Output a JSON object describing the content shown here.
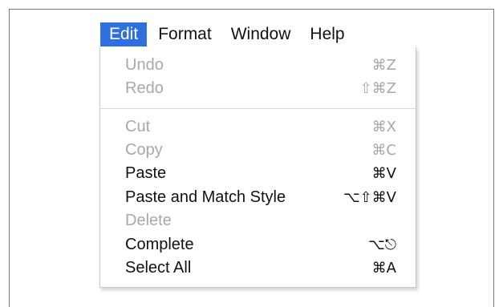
{
  "menubar": {
    "items": [
      {
        "label": "Edit",
        "active": true
      },
      {
        "label": "Format"
      },
      {
        "label": "Window"
      },
      {
        "label": "Help"
      }
    ]
  },
  "edit_menu": {
    "items": [
      {
        "label": "Undo",
        "shortcut": "⌘Z",
        "enabled": false
      },
      {
        "label": "Redo",
        "shortcut": "⇧⌘Z",
        "enabled": false
      },
      {
        "label": "Cut",
        "shortcut": "⌘X",
        "enabled": false
      },
      {
        "label": "Copy",
        "shortcut": "⌘C",
        "enabled": false
      },
      {
        "label": "Paste",
        "shortcut": "⌘V",
        "enabled": true
      },
      {
        "label": "Paste and Match Style",
        "shortcut": "⌥⇧⌘V",
        "enabled": true
      },
      {
        "label": "Delete",
        "shortcut": "",
        "enabled": false
      },
      {
        "label": "Complete",
        "shortcut": "⌥⎋",
        "enabled": true
      },
      {
        "label": "Select All",
        "shortcut": "⌘A",
        "enabled": true
      }
    ]
  },
  "colors": {
    "menubar_highlight": "#2f6fe0",
    "enabled_text": "#111111",
    "disabled_text": "#a8a8a8"
  }
}
